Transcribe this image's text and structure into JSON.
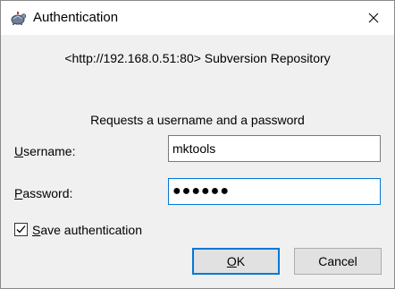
{
  "window": {
    "title": "Authentication",
    "close_symbol": "✕",
    "app_icon": "tortoise-icon",
    "close_icon": "close-icon"
  },
  "dialog": {
    "repository": "<http://192.168.0.51:80> Subversion Repository",
    "prompt": "Requests a username and a password"
  },
  "username": {
    "label_key": "U",
    "label_rest": "sername:",
    "value": "mktools"
  },
  "password": {
    "label_key": "P",
    "label_rest": "assword:",
    "masked_value": "●●●●●●"
  },
  "save_auth": {
    "label_key": "S",
    "label_rest": "ave authentication",
    "checked": true
  },
  "buttons": {
    "ok_key": "O",
    "ok_rest": "K",
    "cancel_label": "Cancel"
  },
  "colors": {
    "focus_accent": "#0078d7",
    "dialog_bg": "#f0f0f0"
  }
}
